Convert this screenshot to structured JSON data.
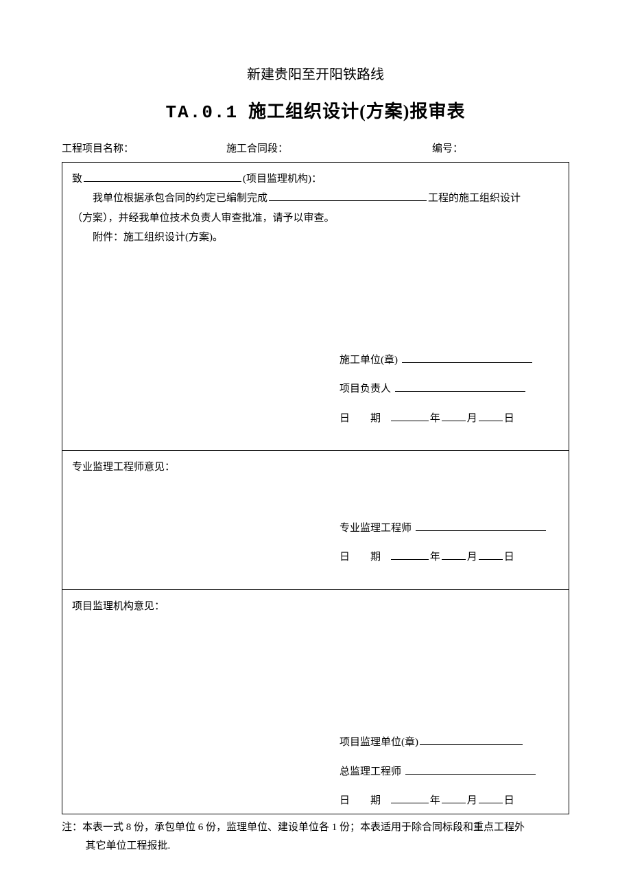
{
  "header_above": "新建贵阳至开阳铁路线",
  "form_code": "TA.0.1",
  "form_title": "施工组织设计(方案)报审表",
  "meta": {
    "project_name_label": "工程项目名称：",
    "contract_section_label": "施工合同段：",
    "number_label": "编号："
  },
  "section1": {
    "to_prefix": "致",
    "to_suffix": "(项目监理机构)：",
    "line1_a": "我单位根据承包合同的约定已编制完成",
    "line1_b": "工程的施工组织设计",
    "line2": "（方案），并经我单位技术负责人审查批准，请予以审查。",
    "attach": "附件：施工组织设计(方案)。",
    "sig": {
      "unit": "施工单位(章)",
      "leader": "项目负责人",
      "date_label": "日期",
      "year": "年",
      "month": "月",
      "day": "日"
    }
  },
  "section2": {
    "heading": "专业监理工程师意见：",
    "sig": {
      "engineer": "专业监理工程师",
      "date_label": "日期",
      "year": "年",
      "month": "月",
      "day": "日"
    }
  },
  "section3": {
    "heading": "项目监理机构意见：",
    "sig": {
      "unit": "项目监理单位(章)",
      "chief": "总监理工程师",
      "date_label": "日期",
      "year": "年",
      "month": "月",
      "day": "日"
    }
  },
  "note": {
    "prefix": "注：",
    "line1": "本表一式 8 份，承包单位 6 份，监理单位、建设单位各 1 份；本表适用于除合同标段和重点工程外",
    "line2": "其它单位工程报批."
  }
}
